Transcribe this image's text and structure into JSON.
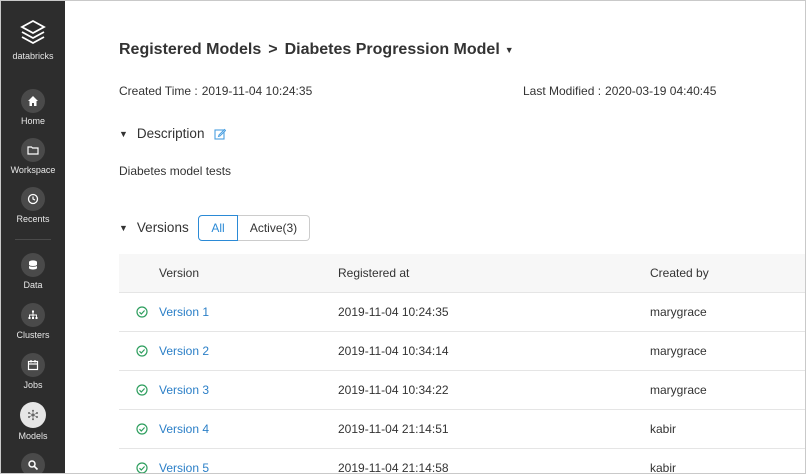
{
  "sidebar": {
    "brand": "databricks",
    "items": [
      {
        "label": "Home",
        "icon": "home-icon"
      },
      {
        "label": "Workspace",
        "icon": "folder-icon"
      },
      {
        "label": "Recents",
        "icon": "clock-icon"
      },
      {
        "label": "Data",
        "icon": "database-icon"
      },
      {
        "label": "Clusters",
        "icon": "cluster-icon"
      },
      {
        "label": "Jobs",
        "icon": "calendar-icon"
      },
      {
        "label": "Models",
        "icon": "models-icon",
        "active": true
      },
      {
        "label": "",
        "icon": "search-icon"
      }
    ]
  },
  "breadcrumb": {
    "parent": "Registered Models",
    "separator": ">",
    "current": "Diabetes Progression Model",
    "caret": "▼"
  },
  "meta": {
    "created_label": "Created Time :",
    "created_value": "2019-11-04 10:24:35",
    "modified_label": "Last Modified :",
    "modified_value": "2020-03-19 04:40:45"
  },
  "description": {
    "heading": "Description",
    "text": "Diabetes model tests"
  },
  "versions": {
    "heading": "Versions",
    "filters": [
      "All",
      "Active(3)"
    ],
    "selected_filter": "All",
    "columns": [
      "Version",
      "Registered at",
      "Created by"
    ],
    "rows": [
      {
        "version": "Version 1",
        "registered_at": "2019-11-04 10:24:35",
        "created_by": "marygrace"
      },
      {
        "version": "Version 2",
        "registered_at": "2019-11-04 10:34:14",
        "created_by": "marygrace"
      },
      {
        "version": "Version 3",
        "registered_at": "2019-11-04 10:34:22",
        "created_by": "marygrace"
      },
      {
        "version": "Version 4",
        "registered_at": "2019-11-04 21:14:51",
        "created_by": "kabir"
      },
      {
        "version": "Version 5",
        "registered_at": "2019-11-04 21:14:58",
        "created_by": "kabir"
      }
    ]
  },
  "colors": {
    "sidebar_bg": "#2d2d2d",
    "accent": "#2b8ad6",
    "status_ready": "#2e9e5e"
  }
}
